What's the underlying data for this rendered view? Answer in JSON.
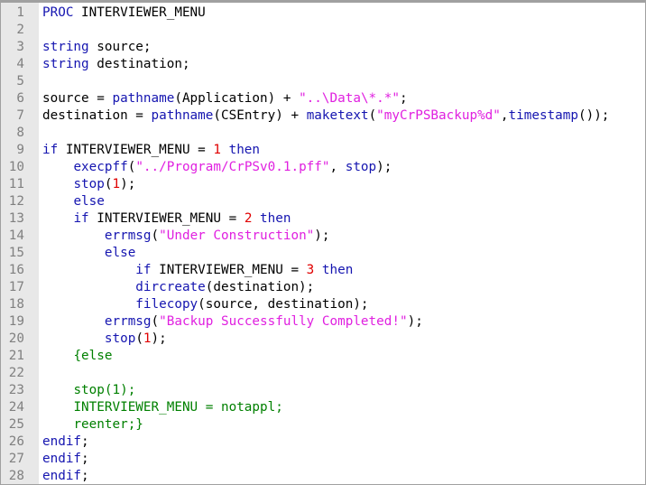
{
  "colors": {
    "keyword": "#1515b0",
    "string": "#e020e0",
    "number": "#e00000",
    "comment": "#008000",
    "gutter": "#e8e8e8"
  },
  "lines": [
    [
      [
        "kw",
        "PROC"
      ],
      [
        "pl",
        " INTERVIEWER_MENU"
      ]
    ],
    [],
    [
      [
        "kw",
        "string"
      ],
      [
        "pl",
        " source;"
      ]
    ],
    [
      [
        "kw",
        "string"
      ],
      [
        "pl",
        " destination;"
      ]
    ],
    [],
    [
      [
        "pl",
        "source = "
      ],
      [
        "kw",
        "pathname"
      ],
      [
        "pl",
        "(Application) + "
      ],
      [
        "str",
        "\"..\\Data\\*.*\""
      ],
      [
        "pl",
        ";"
      ]
    ],
    [
      [
        "pl",
        "destination = "
      ],
      [
        "kw",
        "pathname"
      ],
      [
        "pl",
        "(CSEntry) + "
      ],
      [
        "kw",
        "maketext"
      ],
      [
        "pl",
        "("
      ],
      [
        "str",
        "\"myCrPSBackup%d\""
      ],
      [
        "pl",
        ","
      ],
      [
        "kw",
        "timestamp"
      ],
      [
        "pl",
        "());"
      ]
    ],
    [],
    [
      [
        "kw",
        "if"
      ],
      [
        "pl",
        " INTERVIEWER_MENU = "
      ],
      [
        "num",
        "1"
      ],
      [
        "pl",
        " "
      ],
      [
        "kw",
        "then"
      ]
    ],
    [
      [
        "pl",
        "    "
      ],
      [
        "kw",
        "execpff"
      ],
      [
        "pl",
        "("
      ],
      [
        "str",
        "\"../Program/CrPSv0.1.pff\""
      ],
      [
        "pl",
        ", "
      ],
      [
        "kw",
        "stop"
      ],
      [
        "pl",
        ");"
      ]
    ],
    [
      [
        "pl",
        "    "
      ],
      [
        "kw",
        "stop"
      ],
      [
        "pl",
        "("
      ],
      [
        "num",
        "1"
      ],
      [
        "pl",
        ");"
      ]
    ],
    [
      [
        "pl",
        "    "
      ],
      [
        "kw",
        "else"
      ]
    ],
    [
      [
        "pl",
        "    "
      ],
      [
        "kw",
        "if"
      ],
      [
        "pl",
        " INTERVIEWER_MENU = "
      ],
      [
        "num",
        "2"
      ],
      [
        "pl",
        " "
      ],
      [
        "kw",
        "then"
      ]
    ],
    [
      [
        "pl",
        "        "
      ],
      [
        "kw",
        "errmsg"
      ],
      [
        "pl",
        "("
      ],
      [
        "str",
        "\"Under Construction\""
      ],
      [
        "pl",
        ");"
      ]
    ],
    [
      [
        "pl",
        "        "
      ],
      [
        "kw",
        "else"
      ]
    ],
    [
      [
        "pl",
        "            "
      ],
      [
        "kw",
        "if"
      ],
      [
        "pl",
        " INTERVIEWER_MENU = "
      ],
      [
        "num",
        "3"
      ],
      [
        "pl",
        " "
      ],
      [
        "kw",
        "then"
      ]
    ],
    [
      [
        "pl",
        "            "
      ],
      [
        "kw",
        "dircreate"
      ],
      [
        "pl",
        "(destination);"
      ]
    ],
    [
      [
        "pl",
        "            "
      ],
      [
        "kw",
        "filecopy"
      ],
      [
        "pl",
        "(source, destination);"
      ]
    ],
    [
      [
        "pl",
        "        "
      ],
      [
        "kw",
        "errmsg"
      ],
      [
        "pl",
        "("
      ],
      [
        "str",
        "\"Backup Successfully Completed!\""
      ],
      [
        "pl",
        ");"
      ]
    ],
    [
      [
        "pl",
        "        "
      ],
      [
        "kw",
        "stop"
      ],
      [
        "pl",
        "("
      ],
      [
        "num",
        "1"
      ],
      [
        "pl",
        ");"
      ]
    ],
    [
      [
        "pl",
        "    "
      ],
      [
        "cm",
        "{else"
      ]
    ],
    [],
    [
      [
        "pl",
        "    "
      ],
      [
        "cm",
        "stop(1);"
      ]
    ],
    [
      [
        "pl",
        "    "
      ],
      [
        "cm",
        "INTERVIEWER_MENU = notappl;"
      ]
    ],
    [
      [
        "pl",
        "    "
      ],
      [
        "cm",
        "reenter;}"
      ]
    ],
    [
      [
        "kw",
        "endif"
      ],
      [
        "pl",
        ";"
      ]
    ],
    [
      [
        "kw",
        "endif"
      ],
      [
        "pl",
        ";"
      ]
    ],
    [
      [
        "kw",
        "endif"
      ],
      [
        "pl",
        ";"
      ]
    ]
  ]
}
